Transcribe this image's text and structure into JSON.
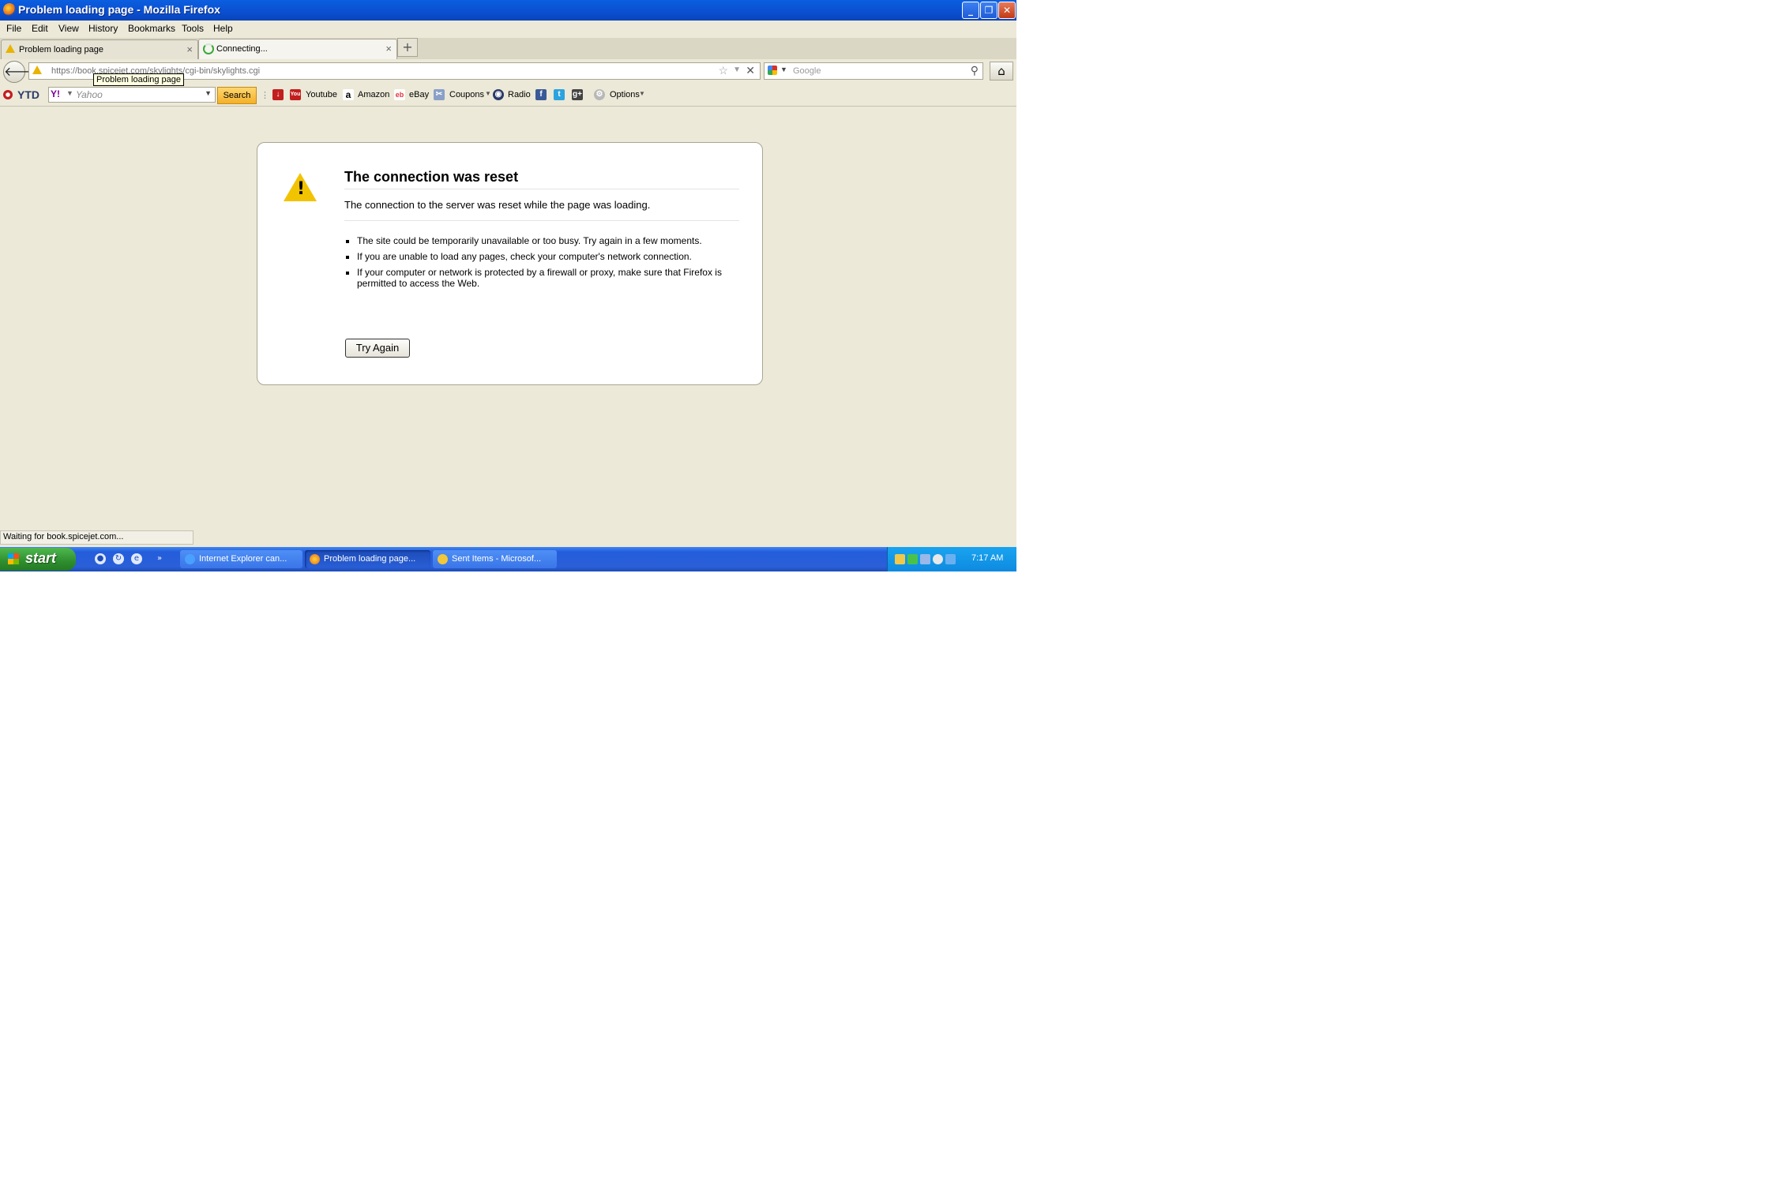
{
  "window": {
    "title": "Problem loading page - Mozilla Firefox",
    "minimize_label": "_",
    "restore_label": "❐",
    "close_label": "✕"
  },
  "menu": {
    "items": [
      "File",
      "Edit",
      "View",
      "History",
      "Bookmarks",
      "Tools",
      "Help"
    ]
  },
  "tabs": [
    {
      "label": "Problem loading page",
      "icon": "warning-icon",
      "close": "×"
    },
    {
      "label": "Connecting...",
      "icon": "loading-icon",
      "close": "×"
    }
  ],
  "new_tab_label": "+",
  "nav": {
    "back_glyph": "🡐",
    "url": "https://book.spicejet.com/skylights/cgi-bin/skylights.cgi",
    "tooltip": "Problem loading page",
    "search_placeholder": "Google",
    "home_glyph": "⌂"
  },
  "toolbar": {
    "ytd_label": "YTD",
    "yahoo_logo": "Y!",
    "yahoo_placeholder": "Yahoo",
    "search_button": "Search",
    "links": [
      "Youtube",
      "Amazon",
      "eBay",
      "Coupons",
      "Radio",
      "Options"
    ]
  },
  "error": {
    "title": "The connection was reset",
    "description": "The connection to the server was reset while the page was loading.",
    "bullets": [
      "The site could be temporarily unavailable or too busy. Try again in a few moments.",
      "If you are unable to load any pages, check your computer's network connection.",
      "If your computer or network is protected by a firewall or proxy, make sure that Firefox is permitted to access the Web."
    ],
    "button": "Try Again"
  },
  "status": {
    "text": "Waiting for book.spicejet.com..."
  },
  "taskbar": {
    "start_label": "start",
    "items": [
      {
        "label": "Internet Explorer can...",
        "icon": "ie-icon",
        "active": false
      },
      {
        "label": "Problem loading page...",
        "icon": "firefox-icon",
        "active": true
      },
      {
        "label": "Sent Items - Microsof...",
        "icon": "outlook-icon",
        "active": false
      }
    ],
    "clock": "7:17 AM"
  }
}
